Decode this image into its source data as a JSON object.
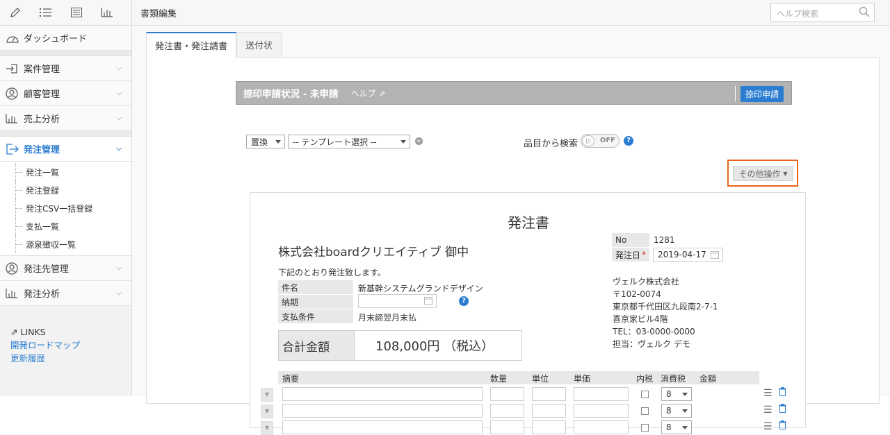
{
  "header": {
    "title": "書類編集",
    "search_placeholder": "ヘルプ検索"
  },
  "toolbar_icons": [
    "pencil-icon",
    "list-icon",
    "detail-list-icon",
    "bar-chart-icon"
  ],
  "sidebar": {
    "dashboard": "ダッシュボード",
    "items": [
      {
        "label": "案件管理"
      },
      {
        "label": "顧客管理"
      },
      {
        "label": "売上分析"
      },
      {
        "label": "発注管理"
      },
      {
        "label": "発注先管理"
      },
      {
        "label": "発注分析"
      }
    ],
    "sub_items": [
      "発注一覧",
      "発注登録",
      "発注CSV一括登録",
      "支払一覧",
      "源泉徴収一覧"
    ],
    "links_title": "LINKS",
    "links": [
      "開発ロードマップ",
      "更新履歴"
    ]
  },
  "tabs": [
    "発注書・発注請書",
    "送付状"
  ],
  "stamp": {
    "status": "捺印申請状況 - 未申請",
    "help": "ヘルプ",
    "button": "捺印申請"
  },
  "controls": {
    "replace": "置換",
    "template": "-- テンプレート選択 --",
    "search_label": "品目から検索",
    "toggle": "OFF",
    "other_ops": "その他操作"
  },
  "doc": {
    "title": "発注書",
    "recipient": "株式会社boardクリエイティブ 御中",
    "note": "下記のとおり発注致します。",
    "fields": [
      {
        "label": "件名",
        "value": "新基幹システムグランドデザイン"
      },
      {
        "label": "納期",
        "value": ""
      },
      {
        "label": "支払条件",
        "value": "月末締翌月末払"
      }
    ],
    "total_label": "合計金額",
    "total_value": "108,000円 （税込）",
    "no_label": "No",
    "no_value": "1281",
    "date_label": "発注日",
    "date_value": "2019-04-17",
    "sender": [
      "ヴェルク株式会社",
      "〒102-0074",
      "東京都千代田区九段南2-7-1",
      "喜京家ビル4階",
      "TEL：03-0000-0000",
      "担当：ヴェルク デモ"
    ]
  },
  "table": {
    "headers": [
      "摘要",
      "数量",
      "単位",
      "単価",
      "内税",
      "消費税",
      "金額"
    ],
    "rows": [
      {
        "tax": "8"
      },
      {
        "tax": "8"
      },
      {
        "tax": "8"
      }
    ]
  }
}
